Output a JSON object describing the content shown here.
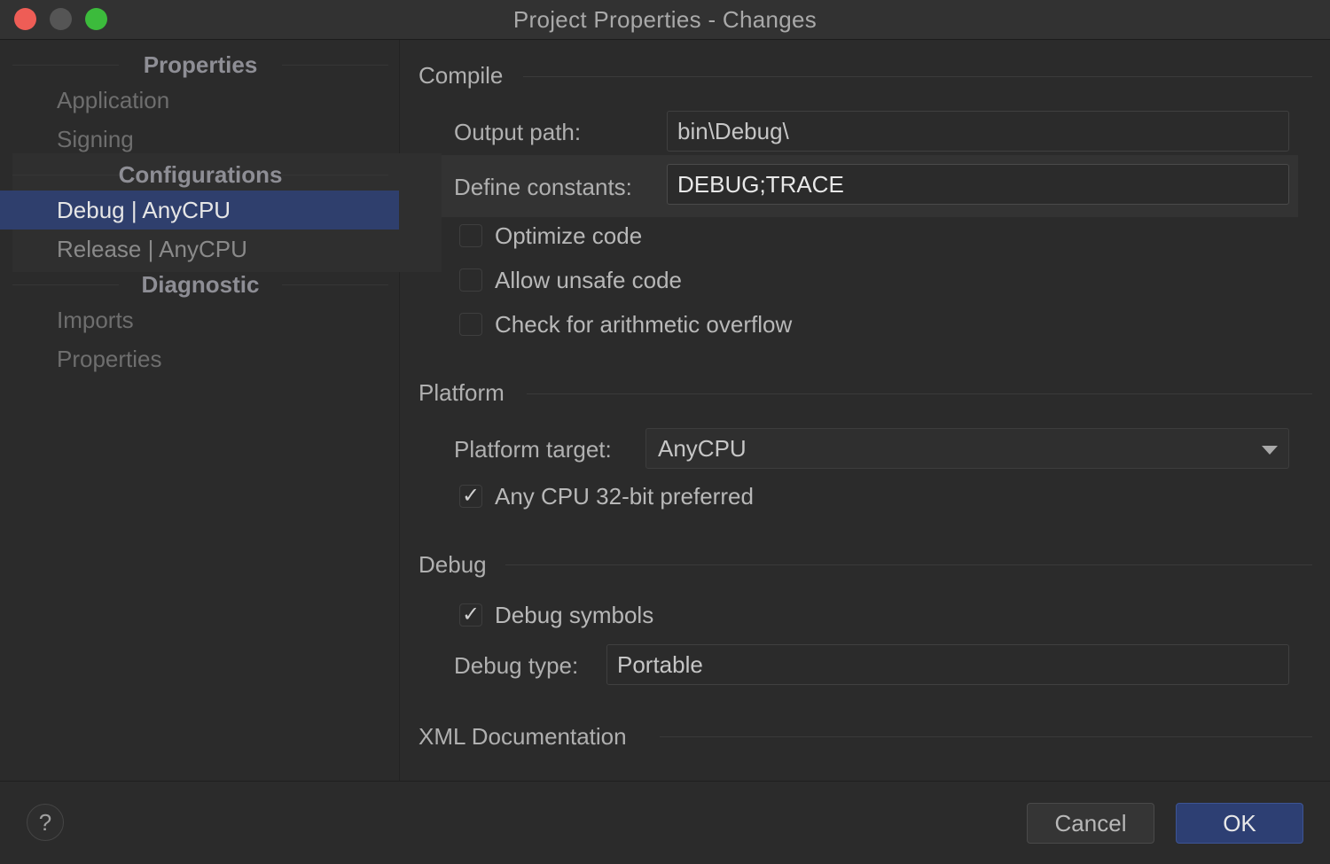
{
  "window": {
    "title": "Project Properties - Changes"
  },
  "sidebar": {
    "groups": [
      {
        "header": "Properties",
        "items": [
          "Application",
          "Signing"
        ]
      },
      {
        "header": "Configurations",
        "items": [
          "Debug | AnyCPU",
          "Release | AnyCPU"
        ],
        "selected": "Debug | AnyCPU"
      },
      {
        "header": "Diagnostic",
        "items": [
          "Imports",
          "Properties"
        ]
      }
    ]
  },
  "compile": {
    "title": "Compile",
    "output_path_label": "Output path:",
    "output_path_value": "bin\\Debug\\",
    "define_constants_label": "Define constants:",
    "define_constants_value": "DEBUG;TRACE",
    "checkboxes": [
      {
        "label": "Optimize code",
        "checked": false
      },
      {
        "label": "Allow unsafe code",
        "checked": false
      },
      {
        "label": "Check for arithmetic overflow",
        "checked": false
      }
    ]
  },
  "platform": {
    "title": "Platform",
    "target_label": "Platform target:",
    "target_value": "AnyCPU",
    "prefer32_label": "Any CPU 32-bit preferred",
    "prefer32_checked": true
  },
  "debug": {
    "title": "Debug",
    "symbols_label": "Debug symbols",
    "symbols_checked": true,
    "type_label": "Debug type:",
    "type_value": "Portable"
  },
  "xml_doc": {
    "title": "XML Documentation"
  },
  "footer": {
    "help_label": "?",
    "cancel_label": "Cancel",
    "ok_label": "OK"
  },
  "check_glyph": "✓",
  "colors": {
    "accent": "#2f3f6d",
    "ok_button": "#2d3f73",
    "close": "#ee5d56",
    "maximize": "#3cbb3c"
  }
}
